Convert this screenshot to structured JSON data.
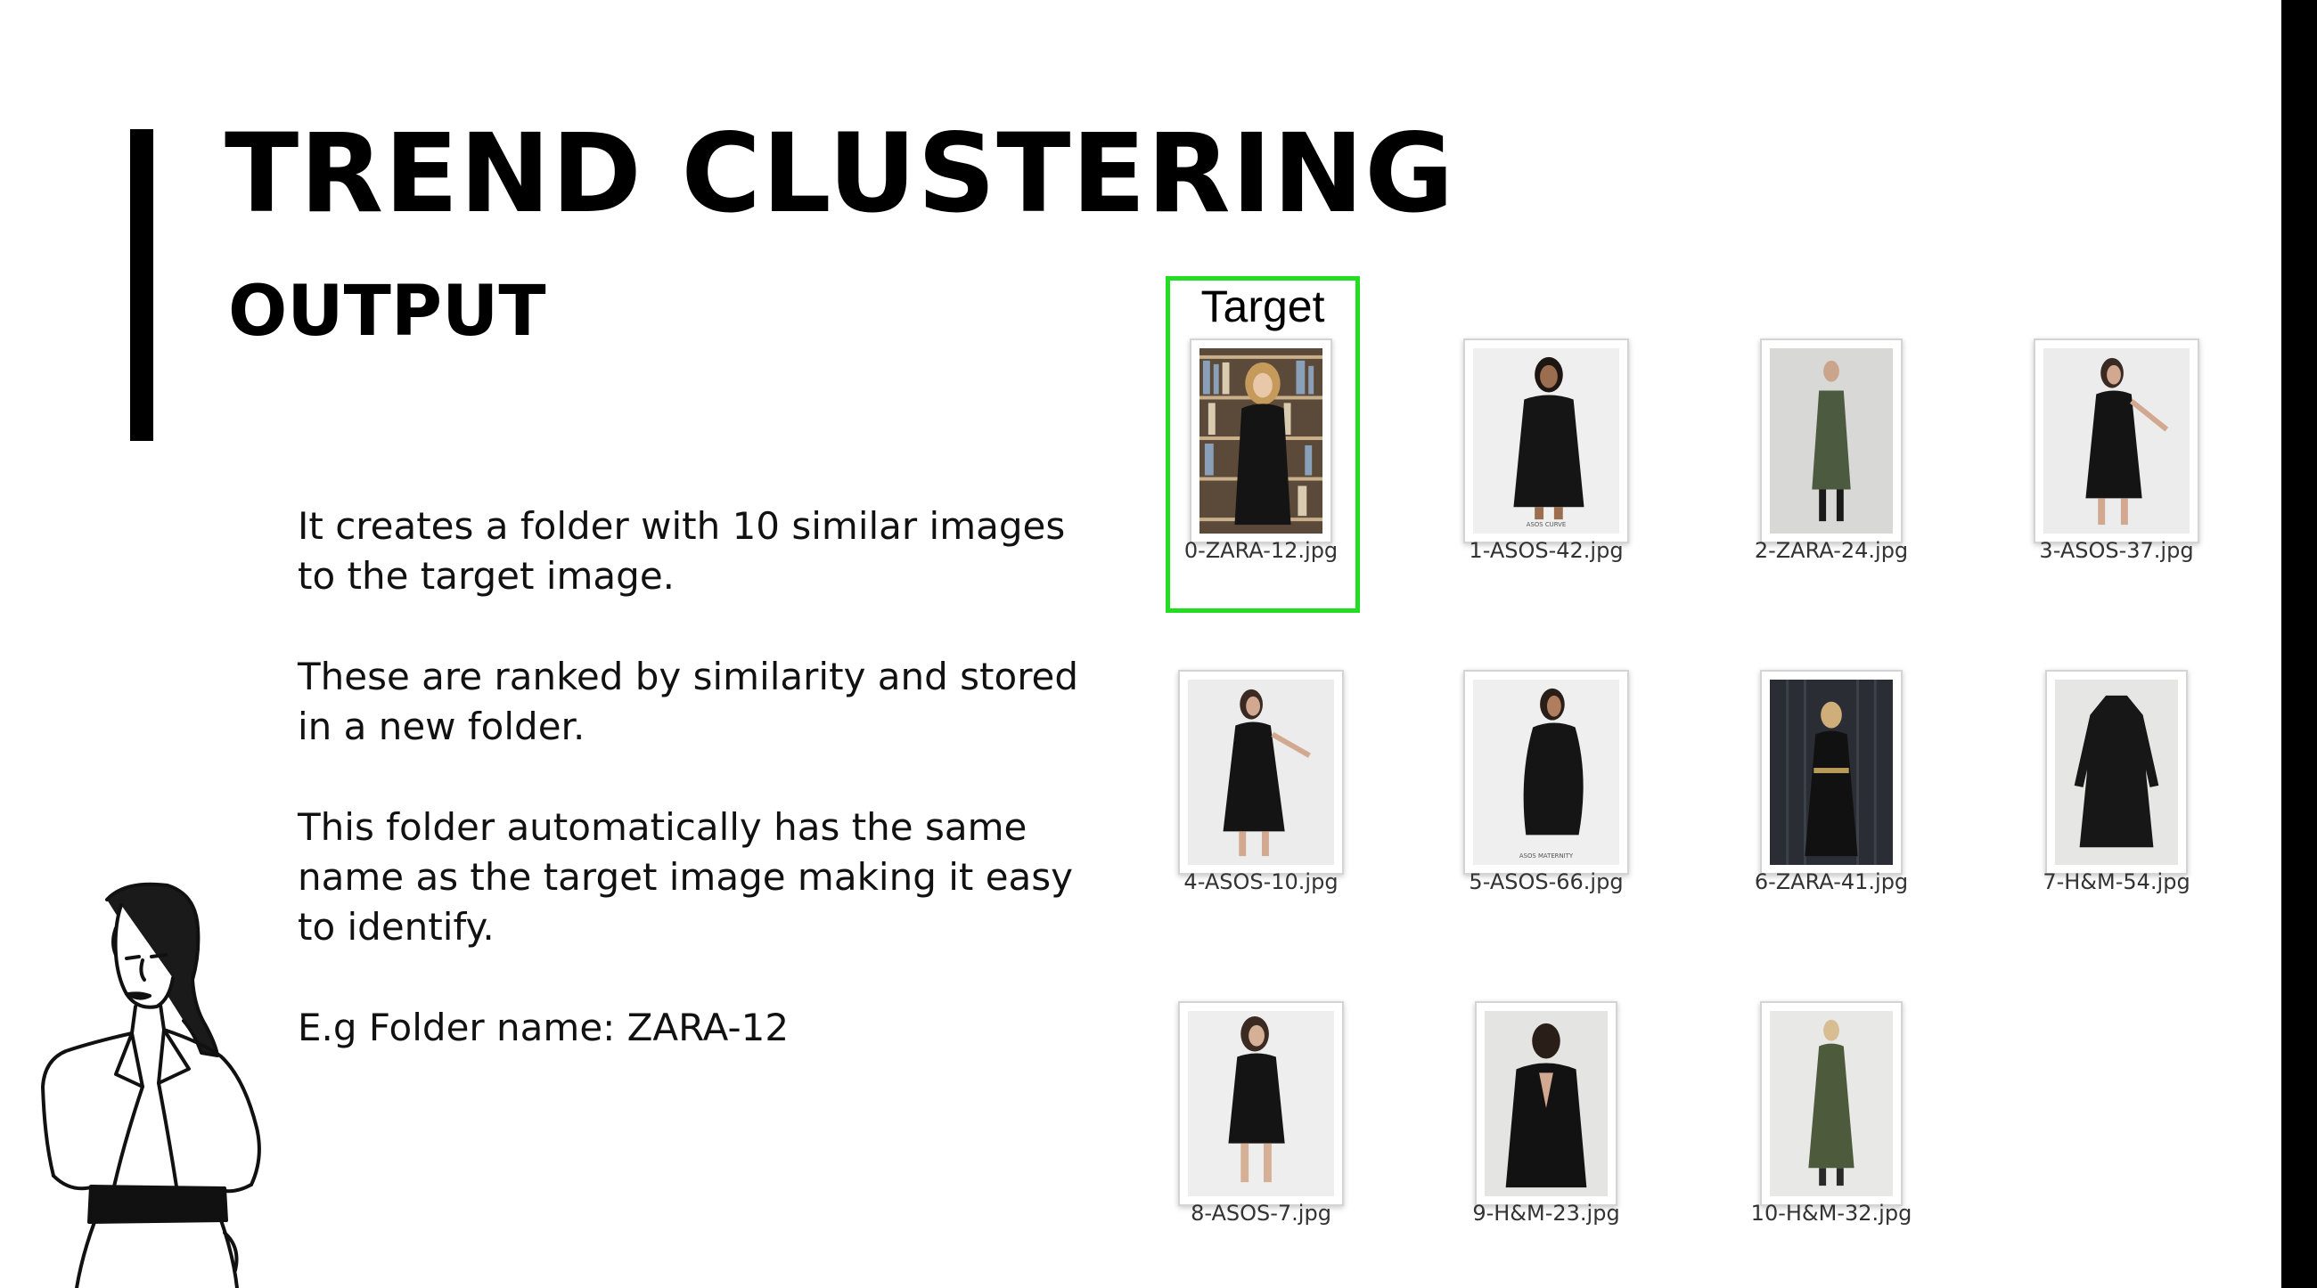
{
  "slide": {
    "title": "TREND CLUSTERING",
    "subtitle": "OUTPUT",
    "paragraphs": [
      "It creates a folder with 10 similar images to the target image.",
      "These are ranked by similarity and stored in a new folder.",
      "This folder automatically has the same name as the target image making it easy to identify.",
      "E.g Folder name: ZARA-12"
    ]
  },
  "gallery": {
    "target_label": "Target",
    "items": [
      {
        "filename": "0-ZARA-12.jpg",
        "image": "woman-in-black-dress-bookshelf"
      },
      {
        "filename": "1-ASOS-42.jpg",
        "image": "woman-in-black-wrap-dress",
        "caption": "ASOS CURVE"
      },
      {
        "filename": "2-ZARA-24.jpg",
        "image": "woman-in-olive-slip-dress"
      },
      {
        "filename": "3-ASOS-37.jpg",
        "image": "woman-in-black-smock-dress"
      },
      {
        "filename": "4-ASOS-10.jpg",
        "image": "woman-in-black-smock-dress"
      },
      {
        "filename": "5-ASOS-66.jpg",
        "image": "woman-in-black-maternity-dress",
        "caption": "ASOS MATERNITY"
      },
      {
        "filename": "6-ZARA-41.jpg",
        "image": "woman-in-black-belted-dress"
      },
      {
        "filename": "7-H&M-54.jpg",
        "image": "black-shirt-dress-product"
      },
      {
        "filename": "8-ASOS-7.jpg",
        "image": "woman-in-black-button-dress"
      },
      {
        "filename": "9-H&M-23.jpg",
        "image": "woman-back-view-black-dress"
      },
      {
        "filename": "10-H&M-32.jpg",
        "image": "woman-in-olive-tiered-dress"
      }
    ]
  },
  "colors": {
    "target_highlight": "#22dd22",
    "accent": "#000000"
  }
}
